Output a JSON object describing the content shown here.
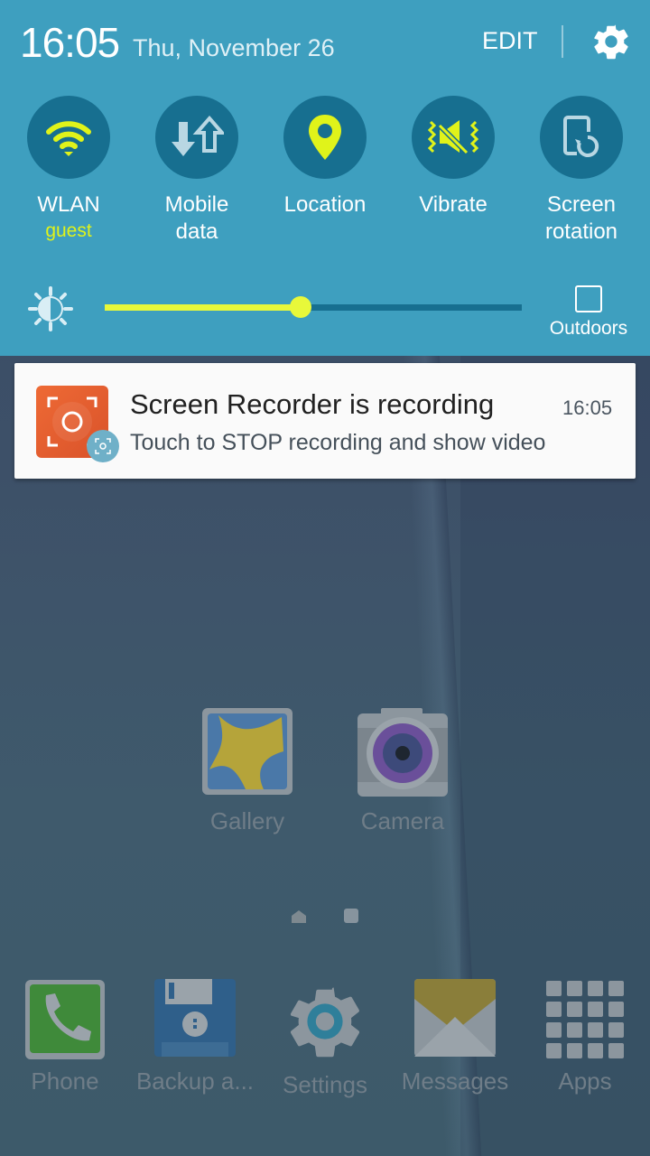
{
  "quick_panel": {
    "time": "16:05",
    "date": "Thu, November 26",
    "edit_label": "EDIT",
    "settings_icon": "gear-icon",
    "accent_color": "#e8f83a",
    "tiles": [
      {
        "id": "wlan",
        "label": "WLAN",
        "sub": "guest",
        "icon": "wifi-icon",
        "active": true
      },
      {
        "id": "mobile-data",
        "label": "Mobile\ndata",
        "icon": "mobile-data-icon",
        "active": false
      },
      {
        "id": "location",
        "label": "Location",
        "icon": "location-pin-icon",
        "active": true
      },
      {
        "id": "vibrate",
        "label": "Vibrate",
        "icon": "vibrate-icon",
        "active": true
      },
      {
        "id": "screen-rotation",
        "label": "Screen\nrotation",
        "icon": "screen-rotation-icon",
        "active": false
      }
    ],
    "brightness": {
      "level": 0.47,
      "icon": "brightness-icon"
    },
    "outdoors": {
      "label": "Outdoors",
      "checked": false
    }
  },
  "notification": {
    "title": "Screen Recorder is recording",
    "time": "16:05",
    "body": "Touch to STOP recording and show video",
    "icon": "screen-recorder-icon"
  },
  "home": {
    "apps": [
      {
        "label": "Gallery",
        "icon": "gallery-icon"
      },
      {
        "label": "Camera",
        "icon": "camera-icon"
      }
    ],
    "dock": [
      {
        "label": "Phone",
        "icon": "phone-icon"
      },
      {
        "label": "Backup a...",
        "icon": "backup-icon"
      },
      {
        "label": "Settings",
        "icon": "settings-icon"
      },
      {
        "label": "Messages",
        "icon": "messages-icon"
      },
      {
        "label": "Apps",
        "icon": "apps-grid-icon"
      }
    ],
    "pages": {
      "count": 2,
      "current": 2
    }
  }
}
